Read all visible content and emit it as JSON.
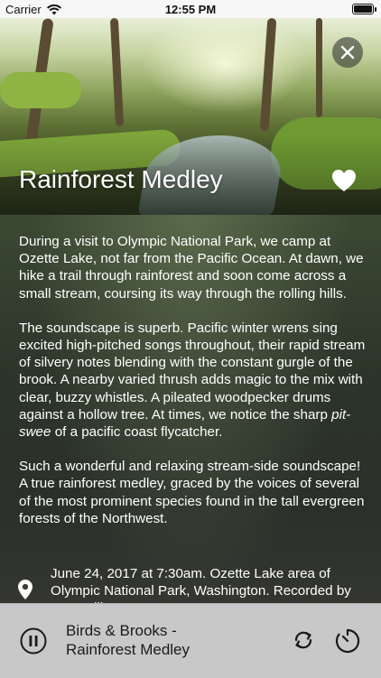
{
  "status_bar": {
    "carrier": "Carrier",
    "time": "12:55 PM",
    "icons": [
      "wifi-icon",
      "battery-icon"
    ]
  },
  "header": {
    "title": "Rainforest Medley",
    "close_icon": "close-icon",
    "favorite_icon": "heart-icon"
  },
  "description": {
    "p1": "During a visit to Olympic National Park, we camp at Ozette Lake, not far from the Pacific Ocean. At dawn, we hike a trail through rainforest and soon come across a small stream, coursing its way through the rolling hills.",
    "p2_before": "The soundscape is superb. Pacific winter wrens sing excited high-pitched songs throughout, their rapid stream of silvery notes blending with the constant gurgle of the brook. A nearby varied thrush adds magic to the mix with clear, buzzy whistles. A pileated woodpecker drums against a hollow tree. At times, we notice the sharp ",
    "p2_italic": "pit-swee",
    "p2_after": " of a pacific coast flycatcher.",
    "p3": "Such a wonderful and relaxing stream-side soundscape! A true rainforest medley, graced by the voices of several of the most prominent species found in the tall evergreen forests of the Northwest."
  },
  "meta": {
    "location_icon": "location-pin-icon",
    "text": "June 24, 2017 at 7:30am. Ozette Lake area of Olympic National Park, Washington. Recorded by Lang Elliott."
  },
  "player": {
    "track_line1": "Birds & Brooks -",
    "track_line2": "Rainforest Medley",
    "icons": [
      "pause-icon",
      "repeat-icon",
      "timer-icon"
    ]
  }
}
